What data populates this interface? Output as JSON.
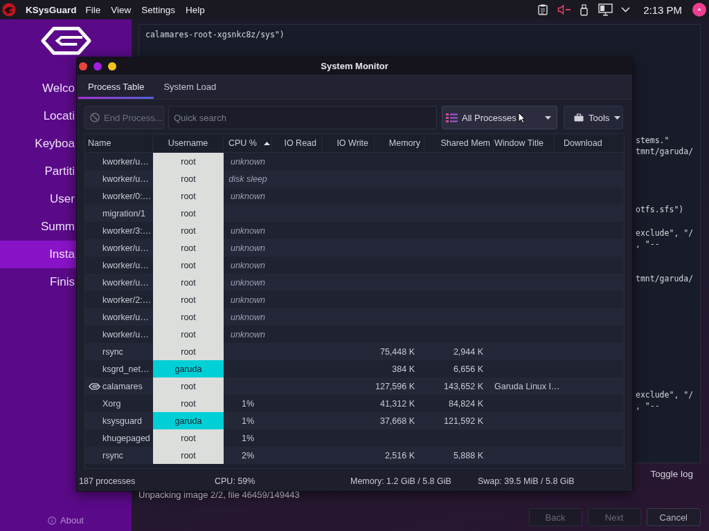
{
  "top_panel": {
    "app_name": "KSysGuard",
    "menu": [
      "File",
      "View",
      "Settings",
      "Help"
    ],
    "clock": "2:13 PM"
  },
  "installer": {
    "sidebar": {
      "items": [
        {
          "label": "Welco",
          "selected": false
        },
        {
          "label": "Locati",
          "selected": false
        },
        {
          "label": "Keyboa",
          "selected": false
        },
        {
          "label": "Partiti",
          "selected": false
        },
        {
          "label": "User",
          "selected": false
        },
        {
          "label": "Summ",
          "selected": false
        },
        {
          "label": "Insta",
          "selected": true
        },
        {
          "label": "Finis",
          "selected": false
        }
      ],
      "about": "About"
    },
    "log": {
      "first_line": "calamares-root-xgsnkc8z/sys\")",
      "fragments": [
        [
          "stems.\"",
          "tmnt/garuda/"
        ],
        [
          "otfs.sfs\")"
        ],
        [
          "exclude\", \"/",
          ", \"--"
        ],
        [
          "tmnt/garuda/"
        ],
        [
          "exclude\", \"/",
          ", \"--"
        ]
      ]
    },
    "toggle_log": "Toggle log",
    "status": "Unpacking image 2/2, file 46459/149443",
    "buttons": [
      {
        "label": "Back",
        "disabled": true
      },
      {
        "label": "Next",
        "disabled": true
      },
      {
        "label": "Cancel",
        "disabled": false
      }
    ]
  },
  "system_monitor": {
    "title": "System Monitor",
    "tabs": [
      {
        "label": "Process Table",
        "selected": true
      },
      {
        "label": "System Load",
        "selected": false
      }
    ],
    "end_process": {
      "label": "End Process...",
      "disabled": true
    },
    "search": {
      "placeholder": "Quick search"
    },
    "filter": {
      "value": "All Processes"
    },
    "tools": {
      "label": "Tools"
    },
    "table": {
      "columns": [
        {
          "label": "Name",
          "sorted": false
        },
        {
          "label": "Username",
          "sorted": false
        },
        {
          "label": "CPU %",
          "sorted": true
        },
        {
          "label": "IO Read",
          "sorted": false
        },
        {
          "label": "IO Write",
          "sorted": false
        },
        {
          "label": "Memory",
          "sorted": false
        },
        {
          "label": "Shared Mem",
          "sorted": false
        },
        {
          "label": "Window Title",
          "sorted": false
        },
        {
          "label": "Download",
          "sorted": false
        }
      ],
      "rows": [
        {
          "name": "kworker/u…",
          "user": "root",
          "color": "#dcdedb",
          "cpu_status": "unknown",
          "icon": false
        },
        {
          "name": "kworker/u…",
          "user": "root",
          "color": "#dcdedb",
          "cpu_status": "disk sleep",
          "icon": false
        },
        {
          "name": "kworker/0:…",
          "user": "root",
          "color": "#dcdedb",
          "cpu_status": "unknown",
          "icon": false
        },
        {
          "name": "migration/1",
          "user": "root",
          "color": "#dcdedb",
          "icon": false
        },
        {
          "name": "kworker/3:…",
          "user": "root",
          "color": "#dcdedb",
          "cpu_status": "unknown",
          "icon": false
        },
        {
          "name": "kworker/u…",
          "user": "root",
          "color": "#dcdedb",
          "cpu_status": "unknown",
          "icon": false
        },
        {
          "name": "kworker/u…",
          "user": "root",
          "color": "#dcdedb",
          "cpu_status": "unknown",
          "icon": false
        },
        {
          "name": "kworker/u…",
          "user": "root",
          "color": "#dcdedb",
          "cpu_status": "unknown",
          "icon": false
        },
        {
          "name": "kworker/2:…",
          "user": "root",
          "color": "#dcdedb",
          "cpu_status": "unknown",
          "icon": false
        },
        {
          "name": "kworker/u…",
          "user": "root",
          "color": "#dcdedb",
          "cpu_status": "unknown",
          "icon": false
        },
        {
          "name": "kworker/u…",
          "user": "root",
          "color": "#dcdedb",
          "cpu_status": "unknown",
          "icon": false
        },
        {
          "name": "rsync",
          "user": "root",
          "color": "#dcdedb",
          "memory": "75,448 K",
          "shared": "2,944 K",
          "icon": false
        },
        {
          "name": "ksgrd_net…",
          "user": "garuda",
          "color": "#00cfd6",
          "memory": "384 K",
          "shared": "6,656 K",
          "icon": false
        },
        {
          "name": "calamares",
          "user": "root",
          "color": "#dcdedb",
          "memory": "127,596 K",
          "shared": "143,652 K",
          "window_title": "Garuda Linux I…",
          "icon": true
        },
        {
          "name": "Xorg",
          "user": "root",
          "color": "#dcdedb",
          "cpu": "1%",
          "memory": "41,312 K",
          "shared": "84,824 K",
          "icon": false
        },
        {
          "name": "ksysguard",
          "user": "garuda",
          "color": "#00cfd6",
          "cpu": "1%",
          "memory": "37,668 K",
          "shared": "121,592 K",
          "icon": false
        },
        {
          "name": "khugepaged",
          "user": "root",
          "color": "#dcdedb",
          "cpu": "1%",
          "icon": false
        },
        {
          "name": "rsync",
          "user": "root",
          "color": "#dcdedb",
          "cpu": "2%",
          "memory": "2,516 K",
          "shared": "5,888 K",
          "icon": false
        }
      ]
    },
    "status_bar": [
      "187 processes",
      "CPU: 59%",
      "Memory: 1.2 GiB / 5.8 GiB",
      "Swap: 39.5 MiB / 5.8 GiB"
    ]
  }
}
